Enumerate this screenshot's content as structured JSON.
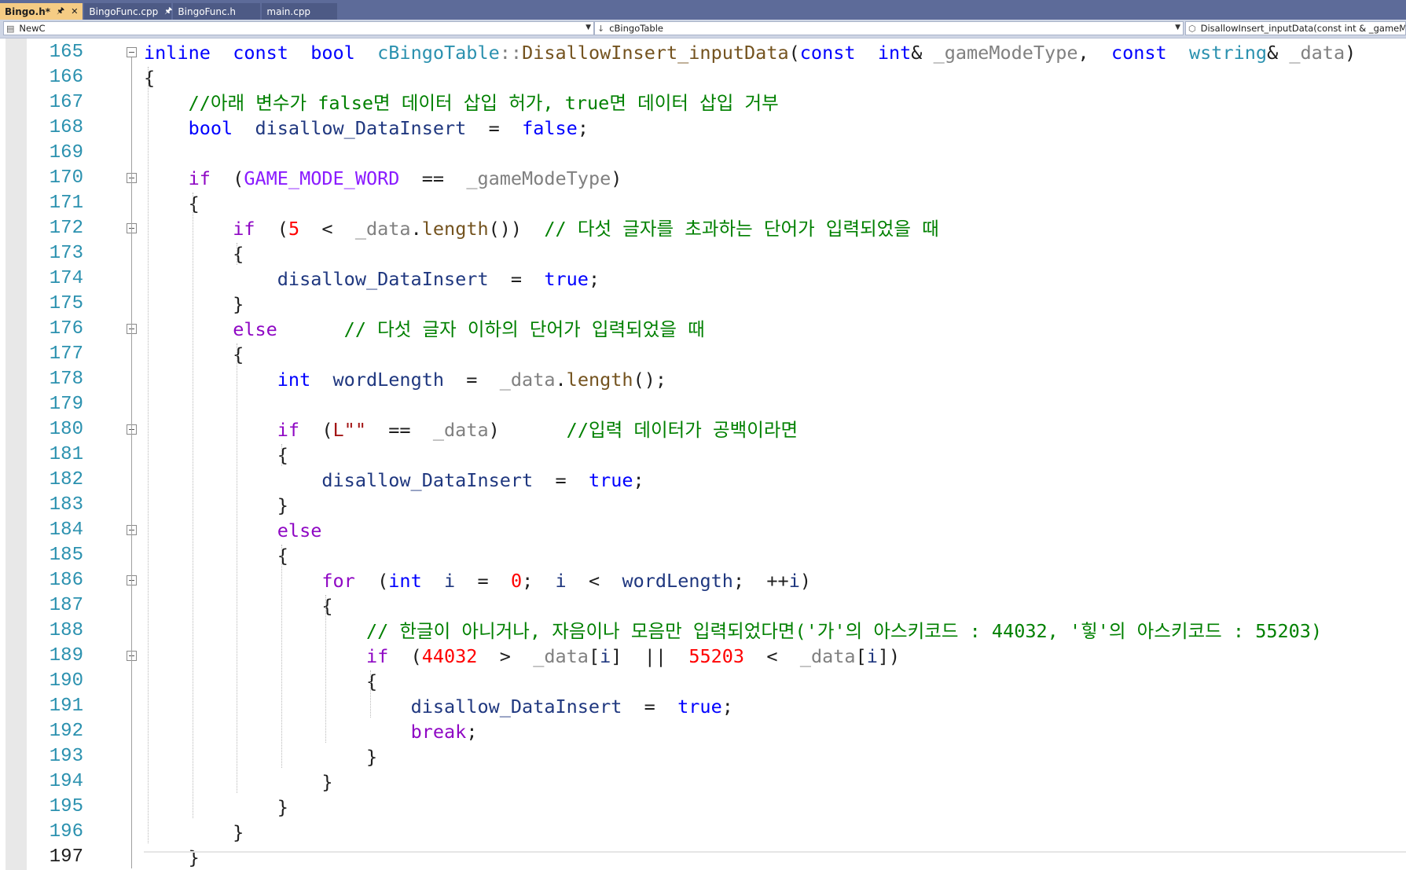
{
  "tabs": [
    {
      "label": "Bingo.h*",
      "active": true,
      "pinned": true,
      "closable": true
    },
    {
      "label": "BingoFunc.cpp",
      "active": false,
      "pinned": true
    },
    {
      "label": "BingoFunc.h",
      "active": false
    },
    {
      "label": "main.cpp",
      "active": false
    }
  ],
  "navbar": {
    "project": "NewC",
    "scope": "cBingoTable",
    "member": "DisallowInsert_inputData(const int & _gameModeType"
  },
  "editor": {
    "current_line": 197,
    "lines": [
      {
        "n": "165",
        "fold": true,
        "code": [
          [
            "kw",
            "inline"
          ],
          [
            "",
            "  "
          ],
          [
            "kw",
            "const"
          ],
          [
            "",
            "  "
          ],
          [
            "kw",
            "bool"
          ],
          [
            "",
            "  "
          ],
          [
            "ty",
            "cBingoTable"
          ],
          [
            "pm",
            "::"
          ],
          [
            "fn",
            "DisallowInsert_inputData"
          ],
          [
            "",
            "("
          ],
          [
            "kw",
            "const"
          ],
          [
            "",
            "  "
          ],
          [
            "kw",
            "int"
          ],
          [
            "",
            "& "
          ],
          [
            "pm",
            "_gameModeType"
          ],
          [
            "",
            ",  "
          ],
          [
            "kw",
            "const"
          ],
          [
            "",
            "  "
          ],
          [
            "ty",
            "wstring"
          ],
          [
            "",
            "& "
          ],
          [
            "pm",
            "_data"
          ],
          [
            "",
            ")"
          ]
        ]
      },
      {
        "n": "166",
        "fold": false,
        "code": [
          [
            "",
            "{"
          ]
        ]
      },
      {
        "n": "167",
        "fold": false,
        "code": [
          [
            "",
            "    "
          ],
          [
            "cm",
            "//아래 변수가 false면 데이터 삽입 허가, true면 데이터 삽입 거부"
          ]
        ]
      },
      {
        "n": "168",
        "fold": false,
        "code": [
          [
            "",
            "    "
          ],
          [
            "kw",
            "bool"
          ],
          [
            "",
            "  "
          ],
          [
            "var",
            "disallow_DataInsert"
          ],
          [
            "",
            "  =  "
          ],
          [
            "kw",
            "false"
          ],
          [
            "",
            ";"
          ]
        ]
      },
      {
        "n": "169",
        "fold": false,
        "code": []
      },
      {
        "n": "170",
        "fold": true,
        "code": [
          [
            "",
            "    "
          ],
          [
            "ctl",
            "if"
          ],
          [
            "",
            "  ("
          ],
          [
            "mac",
            "GAME_MODE_WORD"
          ],
          [
            "",
            "  ==  "
          ],
          [
            "pm",
            "_gameModeType"
          ],
          [
            "",
            ")"
          ]
        ]
      },
      {
        "n": "171",
        "fold": false,
        "code": [
          [
            "",
            "    {"
          ]
        ]
      },
      {
        "n": "172",
        "fold": true,
        "code": [
          [
            "",
            "        "
          ],
          [
            "ctl",
            "if"
          ],
          [
            "",
            "  ("
          ],
          [
            "num",
            "5"
          ],
          [
            "",
            "  <  "
          ],
          [
            "pm",
            "_data"
          ],
          [
            "",
            "."
          ],
          [
            "fn",
            "length"
          ],
          [
            "",
            "())  "
          ],
          [
            "cm",
            "// 다섯 글자를 초과하는 단어가 입력되었을 때"
          ]
        ]
      },
      {
        "n": "173",
        "fold": false,
        "code": [
          [
            "",
            "        {"
          ]
        ]
      },
      {
        "n": "174",
        "fold": false,
        "code": [
          [
            "",
            "            "
          ],
          [
            "var",
            "disallow_DataInsert"
          ],
          [
            "",
            "  =  "
          ],
          [
            "kw",
            "true"
          ],
          [
            "",
            ";"
          ]
        ]
      },
      {
        "n": "175",
        "fold": false,
        "code": [
          [
            "",
            "        }"
          ]
        ]
      },
      {
        "n": "176",
        "fold": true,
        "code": [
          [
            "",
            "        "
          ],
          [
            "ctl",
            "else"
          ],
          [
            "",
            "      "
          ],
          [
            "cm",
            "// 다섯 글자 이하의 단어가 입력되었을 때"
          ]
        ]
      },
      {
        "n": "177",
        "fold": false,
        "code": [
          [
            "",
            "        {"
          ]
        ]
      },
      {
        "n": "178",
        "fold": false,
        "code": [
          [
            "",
            "            "
          ],
          [
            "kw",
            "int"
          ],
          [
            "",
            "  "
          ],
          [
            "var",
            "wordLength"
          ],
          [
            "",
            "  =  "
          ],
          [
            "pm",
            "_data"
          ],
          [
            "",
            "."
          ],
          [
            "fn",
            "length"
          ],
          [
            "",
            "();"
          ]
        ]
      },
      {
        "n": "179",
        "fold": false,
        "code": []
      },
      {
        "n": "180",
        "fold": true,
        "code": [
          [
            "",
            "            "
          ],
          [
            "ctl",
            "if"
          ],
          [
            "",
            "  ("
          ],
          [
            "str",
            "L\"\""
          ],
          [
            "",
            "  ==  "
          ],
          [
            "pm",
            "_data"
          ],
          [
            "",
            ")      "
          ],
          [
            "cm",
            "//입력 데이터가 공백이라면"
          ]
        ]
      },
      {
        "n": "181",
        "fold": false,
        "code": [
          [
            "",
            "            {"
          ]
        ]
      },
      {
        "n": "182",
        "fold": false,
        "code": [
          [
            "",
            "                "
          ],
          [
            "var",
            "disallow_DataInsert"
          ],
          [
            "",
            "  =  "
          ],
          [
            "kw",
            "true"
          ],
          [
            "",
            ";"
          ]
        ]
      },
      {
        "n": "183",
        "fold": false,
        "code": [
          [
            "",
            "            }"
          ]
        ]
      },
      {
        "n": "184",
        "fold": true,
        "code": [
          [
            "",
            "            "
          ],
          [
            "ctl",
            "else"
          ]
        ]
      },
      {
        "n": "185",
        "fold": false,
        "code": [
          [
            "",
            "            {"
          ]
        ]
      },
      {
        "n": "186",
        "fold": true,
        "code": [
          [
            "",
            "                "
          ],
          [
            "ctl",
            "for"
          ],
          [
            "",
            "  ("
          ],
          [
            "kw",
            "int"
          ],
          [
            "",
            "  "
          ],
          [
            "var",
            "i"
          ],
          [
            "",
            "  =  "
          ],
          [
            "num",
            "0"
          ],
          [
            "",
            ";  "
          ],
          [
            "var",
            "i"
          ],
          [
            "",
            "  <  "
          ],
          [
            "var",
            "wordLength"
          ],
          [
            "",
            ";  ++"
          ],
          [
            "var",
            "i"
          ],
          [
            "",
            ")"
          ]
        ]
      },
      {
        "n": "187",
        "fold": false,
        "code": [
          [
            "",
            "                {"
          ]
        ]
      },
      {
        "n": "188",
        "fold": false,
        "code": [
          [
            "",
            "                    "
          ],
          [
            "cm",
            "// 한글이 아니거나, 자음이나 모음만 입력되었다면('가'의 아스키코드 : 44032, '힣'의 아스키코드 : 55203)"
          ]
        ]
      },
      {
        "n": "189",
        "fold": true,
        "code": [
          [
            "",
            "                    "
          ],
          [
            "ctl",
            "if"
          ],
          [
            "",
            "  ("
          ],
          [
            "num",
            "44032"
          ],
          [
            "",
            "  >  "
          ],
          [
            "pm",
            "_data"
          ],
          [
            "",
            "["
          ],
          [
            "var",
            "i"
          ],
          [
            "",
            "]  ||  "
          ],
          [
            "num",
            "55203"
          ],
          [
            "",
            "  <  "
          ],
          [
            "pm",
            "_data"
          ],
          [
            "",
            "["
          ],
          [
            "var",
            "i"
          ],
          [
            "",
            "])"
          ]
        ]
      },
      {
        "n": "190",
        "fold": false,
        "code": [
          [
            "",
            "                    {"
          ]
        ]
      },
      {
        "n": "191",
        "fold": false,
        "code": [
          [
            "",
            "                        "
          ],
          [
            "var",
            "disallow_DataInsert"
          ],
          [
            "",
            "  =  "
          ],
          [
            "kw",
            "true"
          ],
          [
            "",
            ";"
          ]
        ]
      },
      {
        "n": "192",
        "fold": false,
        "code": [
          [
            "",
            "                        "
          ],
          [
            "ctl",
            "break"
          ],
          [
            "",
            ";"
          ]
        ]
      },
      {
        "n": "193",
        "fold": false,
        "code": [
          [
            "",
            "                    }"
          ]
        ]
      },
      {
        "n": "194",
        "fold": false,
        "code": [
          [
            "",
            "                }"
          ]
        ]
      },
      {
        "n": "195",
        "fold": false,
        "code": [
          [
            "",
            "            }"
          ]
        ]
      },
      {
        "n": "196",
        "fold": false,
        "code": [
          [
            "",
            "        }"
          ]
        ]
      },
      {
        "n": "197",
        "fold": false,
        "code": [
          [
            "",
            "    }"
          ]
        ]
      }
    ]
  }
}
